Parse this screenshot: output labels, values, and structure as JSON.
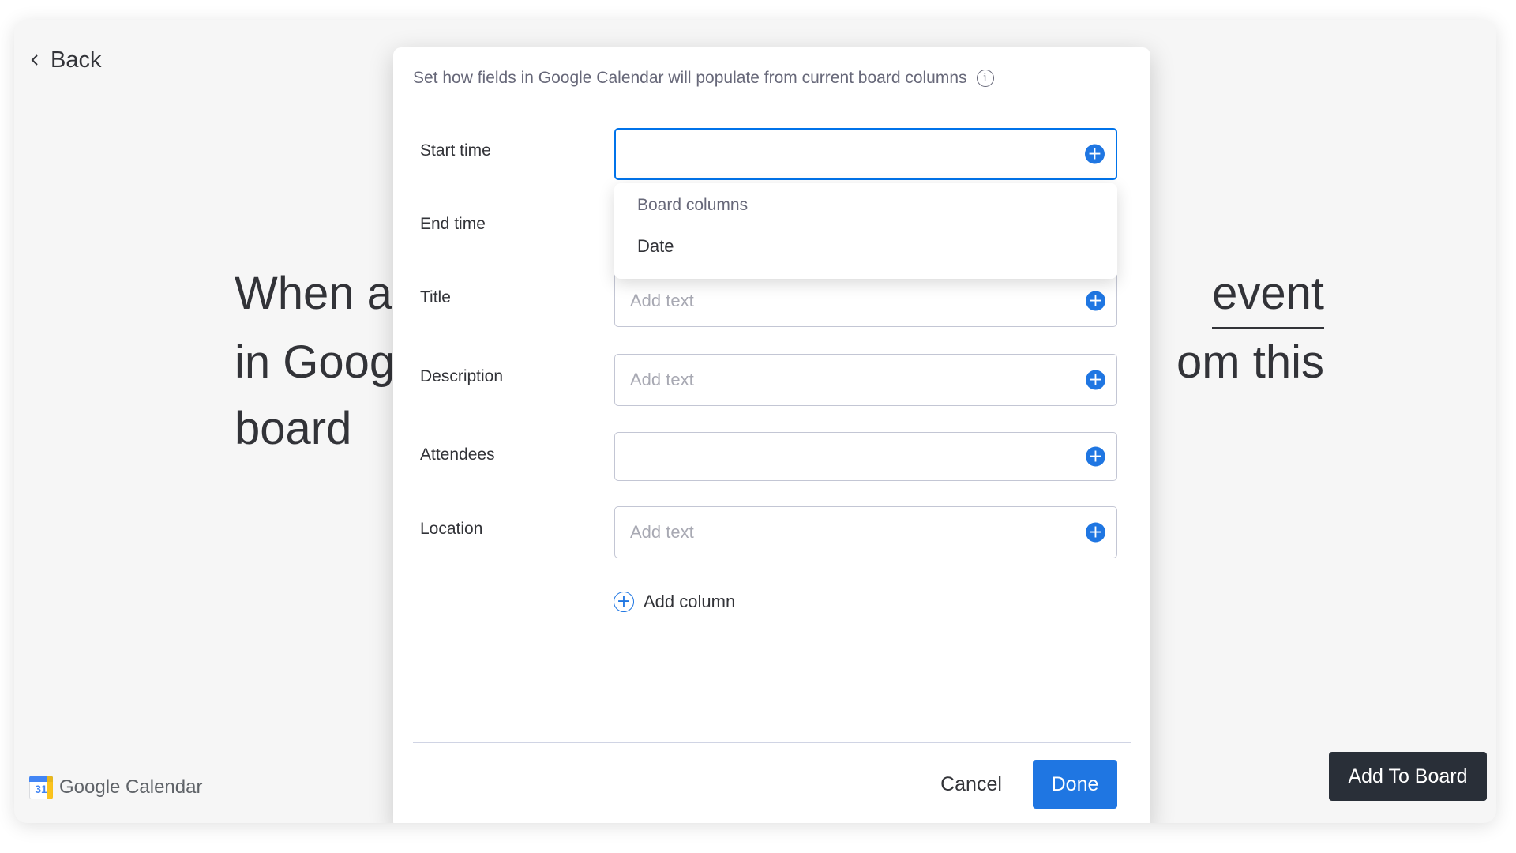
{
  "page": {
    "back_label": "Back",
    "recipe_lines": [
      "When a",
      "event",
      "in Goog",
      "om this",
      "board"
    ],
    "brand_name": "Google Calendar",
    "brand_icon_number": "31",
    "add_to_board_label": "Add To Board"
  },
  "modal": {
    "header": "Set how fields in Google Calendar will populate from current board columns",
    "fields": [
      {
        "label": "Start time",
        "value": "",
        "placeholder": ""
      },
      {
        "label": "End time",
        "value": "",
        "placeholder": ""
      },
      {
        "label": "Title",
        "value": "",
        "placeholder": "Add text"
      },
      {
        "label": "Description",
        "value": "",
        "placeholder": "Add text"
      },
      {
        "label": "Attendees",
        "value": "",
        "placeholder": ""
      },
      {
        "label": "Location",
        "value": "",
        "placeholder": "Add text"
      }
    ],
    "dropdown": {
      "section_label": "Board columns",
      "options": [
        "Date"
      ]
    },
    "add_column_label": "Add column",
    "cancel_label": "Cancel",
    "done_label": "Done"
  },
  "colors": {
    "primary": "#1f76e2",
    "dark_button": "#292f38",
    "text": "#323338",
    "muted_text": "#676879",
    "background": "#f6f6f6"
  },
  "icons": {
    "back": "chevron-left-icon",
    "info": "info-icon",
    "plus": "plus-circle-icon",
    "add_column": "plus-outline-circle-icon",
    "brand": "google-calendar-icon"
  }
}
